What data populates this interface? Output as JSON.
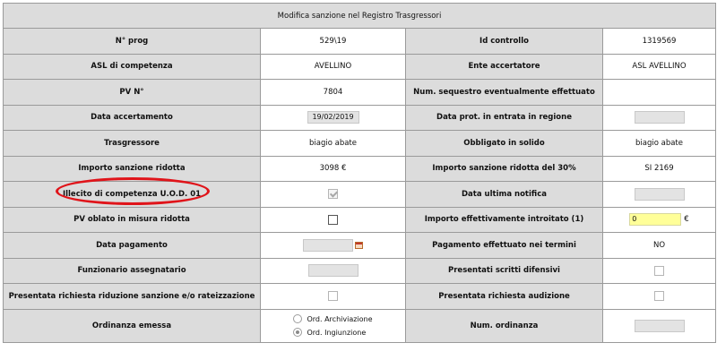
{
  "header": {
    "title": "Modifica sanzione nel Registro Trasgressori"
  },
  "rows": [
    {
      "l1": "N° prog",
      "v1": "529\\19",
      "l2": "Id controllo",
      "v2": "1319569"
    },
    {
      "l1": "ASL di competenza",
      "v1": "AVELLINO",
      "l2": "Ente accertatore",
      "v2": "ASL AVELLINO"
    },
    {
      "l1": "PV N°",
      "v1": "7804",
      "l2": "Num. sequestro eventualmente effettuato",
      "v2": ""
    },
    {
      "l1": "Data accertamento",
      "v1": "19/02/2019",
      "l2": "Data prot. in entrata in regione",
      "v2": ""
    },
    {
      "l1": "Trasgressore",
      "v1": "biagio abate",
      "l2": "Obbligato in solido",
      "v2": "biagio abate"
    },
    {
      "l1": "Importo sanzione ridotta",
      "v1": "3098 €",
      "l2": "Importo sanzione ridotta del 30%",
      "v2": "SI 2169"
    },
    {
      "l1": "Illecito di competenza U.O.D. 01",
      "v1_checked": true,
      "l2": "Data ultima notifica",
      "v2": ""
    },
    {
      "l1": "PV oblato in misura ridotta",
      "v1_checked": false,
      "l2": "Importo effettivamente introitato (1)",
      "v2": "0",
      "v2_unit": "€"
    },
    {
      "l1": "Data pagamento",
      "v1": "",
      "l2": "Pagamento effettuato nei termini",
      "v2": "NO"
    },
    {
      "l1": "Funzionario assegnatario",
      "v1": "",
      "l2": "Presentati scritti difensivi",
      "v2_checked": false
    },
    {
      "l1": "Presentata richiesta riduzione sanzione e/o rateizzazione",
      "v1_checked": false,
      "l2": "Presentata richiesta audizione",
      "v2_checked": false
    },
    {
      "l1": "Ordinanza emessa",
      "options": [
        "Ord. Archiviazione",
        "Ord. Ingiunzione"
      ],
      "selected_option": "Ord. Ingiunzione",
      "l2": "Num. ordinanza",
      "v2": ""
    }
  ],
  "colors": {
    "label_bg": "#dcdcdc",
    "input_bg": "#e3e3e3",
    "highlight_input": "#ffff99",
    "annotation": "#e0141a"
  },
  "icons": {
    "calendar": "calendar-icon"
  }
}
